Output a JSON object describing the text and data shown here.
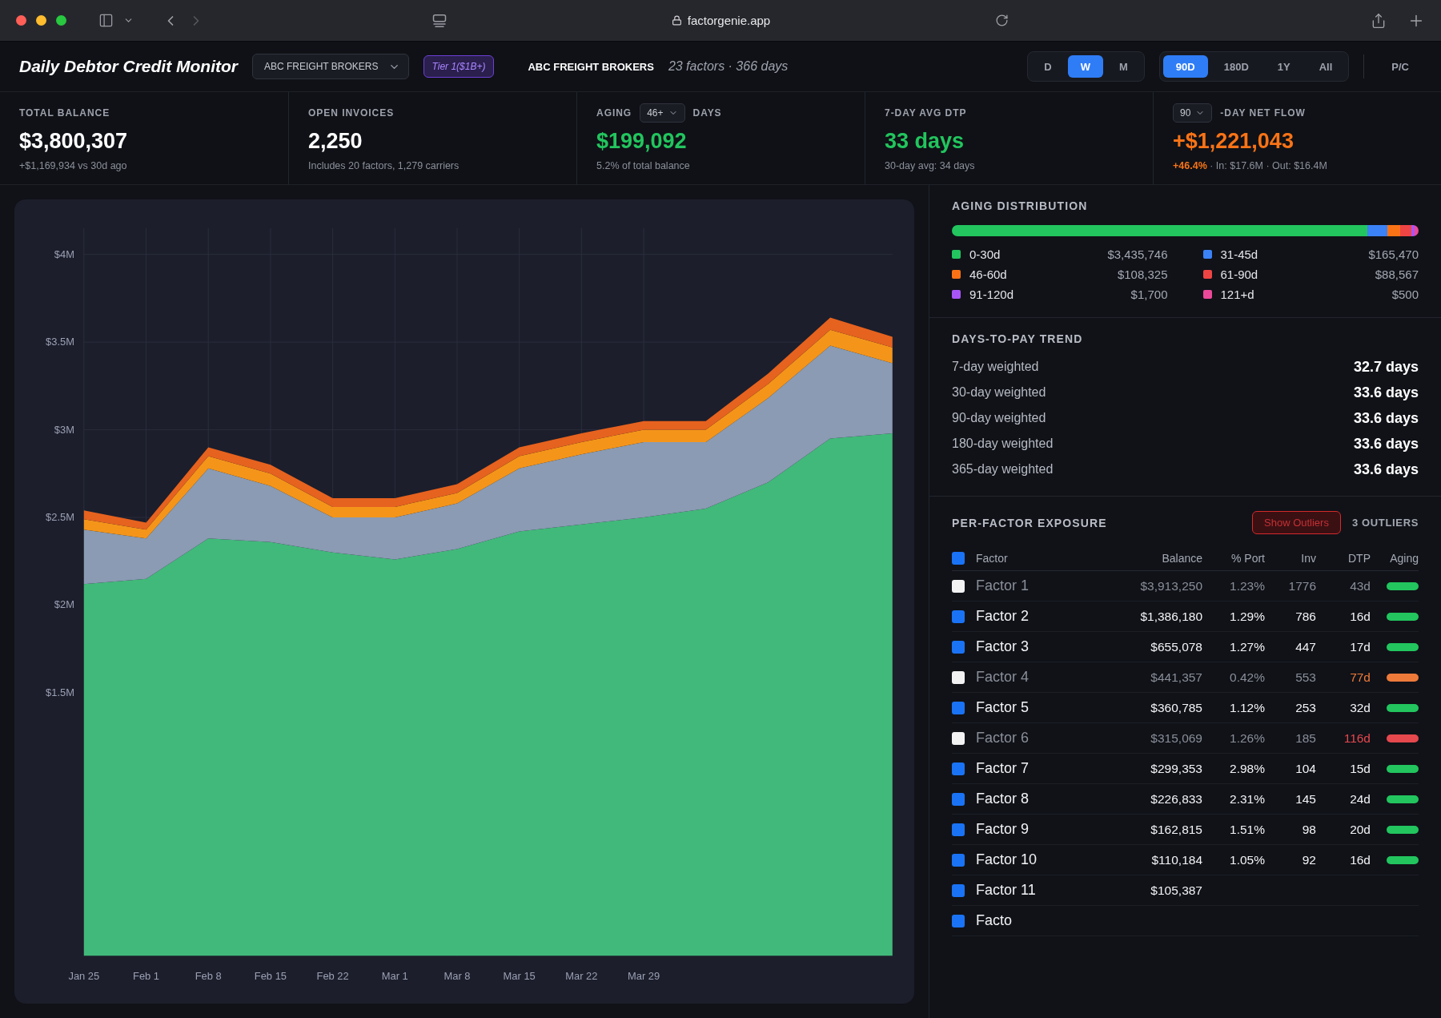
{
  "browser": {
    "url": "factorgenie.app"
  },
  "header": {
    "title": "Daily Debtor Credit Monitor",
    "broker_select": "ABC FREIGHT BROKERS",
    "tier_badge": "Tier 1($1B+)",
    "broker_name": "ABC FREIGHT BROKERS",
    "summary": "23 factors · 366 days",
    "range_groups": [
      {
        "options": [
          {
            "label": "D",
            "selected": false
          },
          {
            "label": "W",
            "selected": true
          },
          {
            "label": "M",
            "selected": false
          }
        ]
      },
      {
        "options": [
          {
            "label": "90D",
            "selected": true
          },
          {
            "label": "180D",
            "selected": false
          },
          {
            "label": "1Y",
            "selected": false
          },
          {
            "label": "All",
            "selected": false
          }
        ]
      }
    ],
    "pc_toggle": {
      "label": "P/C",
      "selected": false
    }
  },
  "kpis": [
    {
      "label_parts": [
        {
          "kind": "text",
          "text": "TOTAL BALANCE"
        }
      ],
      "value": "$3,800,307",
      "color": "#ffffff",
      "note": "+$1,169,934 vs 30d ago"
    },
    {
      "label_parts": [
        {
          "kind": "text",
          "text": "OPEN INVOICES"
        }
      ],
      "value": "2,250",
      "color": "#ffffff",
      "note": "Includes 20 factors, 1,279 carriers"
    },
    {
      "label_parts": [
        {
          "kind": "text",
          "text": "AGING"
        },
        {
          "kind": "select",
          "value": "46+"
        },
        {
          "kind": "text",
          "text": "DAYS"
        }
      ],
      "value": "$199,092",
      "color": "#22c55e",
      "note": "5.2% of total balance"
    },
    {
      "label_parts": [
        {
          "kind": "text",
          "text": "7-DAY AVG DTP"
        }
      ],
      "value": "33 days",
      "color": "#22c55e",
      "note": "30-day avg: 34 days"
    },
    {
      "label_parts": [
        {
          "kind": "select",
          "value": "90"
        },
        {
          "kind": "text",
          "text": "-DAY NET FLOW"
        }
      ],
      "value": "+$1,221,043",
      "color": "#f97316",
      "note_lead": "+46.4%",
      "note": "· In: $17.6M · Out: $16.4M"
    }
  ],
  "chart": {
    "chart_data": {
      "type": "area",
      "stacked": true,
      "grid": true,
      "categories": [
        "Jan 25",
        "Feb 1",
        "Feb 8",
        "Feb 15",
        "Feb 22",
        "Mar 1",
        "Mar 8",
        "Mar 15",
        "Mar 22",
        "Mar 29",
        null,
        null,
        null,
        null
      ],
      "ylim": [
        0,
        4150000
      ],
      "yticks": [
        {
          "value": 1500000,
          "label": "$1.5M"
        },
        {
          "value": 2000000,
          "label": "$2M"
        },
        {
          "value": 2500000,
          "label": "$2.5M"
        },
        {
          "value": 3000000,
          "label": "$3M"
        },
        {
          "value": 3500000,
          "label": "$3.5M"
        },
        {
          "value": 4000000,
          "label": "$4M"
        }
      ],
      "series": [
        {
          "color": "#41b97a",
          "values": [
            2120000,
            2150000,
            2380000,
            2360000,
            2300000,
            2260000,
            2320000,
            2420000,
            2460000,
            2500000,
            2550000,
            2700000,
            2950000,
            2980000
          ]
        },
        {
          "color": "#8a9bb3",
          "values": [
            310000,
            230000,
            400000,
            320000,
            200000,
            240000,
            260000,
            360000,
            400000,
            430000,
            380000,
            480000,
            530000,
            400000
          ]
        },
        {
          "color": "#f4951a",
          "values": [
            60000,
            50000,
            70000,
            70000,
            60000,
            60000,
            60000,
            70000,
            70000,
            70000,
            70000,
            80000,
            90000,
            90000
          ]
        },
        {
          "color": "#e6621f",
          "values": [
            50000,
            40000,
            50000,
            50000,
            50000,
            50000,
            50000,
            50000,
            50000,
            50000,
            50000,
            60000,
            70000,
            60000
          ]
        }
      ]
    }
  },
  "aging_distribution": {
    "title": "AGING DISTRIBUTION",
    "buckets": [
      {
        "label": "0-30d",
        "amount": "$3,435,746",
        "color": "#22c55e"
      },
      {
        "label": "31-45d",
        "amount": "$165,470",
        "color": "#3b82f6"
      },
      {
        "label": "46-60d",
        "amount": "$108,325",
        "color": "#f97316"
      },
      {
        "label": "61-90d",
        "amount": "$88,567",
        "color": "#ef4444"
      },
      {
        "label": "91-120d",
        "amount": "$1,700",
        "color": "#a855f7"
      },
      {
        "label": "121+d",
        "amount": "$500",
        "color": "#ec4899"
      }
    ]
  },
  "dtp_trend": {
    "title": "DAYS-TO-PAY TREND",
    "rows": [
      {
        "label": "7-day weighted",
        "value": "32.7 days"
      },
      {
        "label": "30-day weighted",
        "value": "33.6 days"
      },
      {
        "label": "90-day weighted",
        "value": "33.6 days"
      },
      {
        "label": "180-day weighted",
        "value": "33.6 days"
      },
      {
        "label": "365-day weighted",
        "value": "33.6 days"
      }
    ]
  },
  "exposure": {
    "title": "PER-FACTOR EXPOSURE",
    "outliers_button": "Show Outliers",
    "outliers_count": "3 OUTLIERS",
    "select_all": {
      "label": "Factor",
      "checked": true
    },
    "columns": [
      "Balance",
      "% Port",
      "Inv",
      "DTP",
      "Aging"
    ],
    "rows": [
      {
        "name": "Factor 1",
        "checked": false,
        "balance": "$3,913,250",
        "port": "1.23%",
        "inv": "1776",
        "dtp": "43d",
        "flagged": false,
        "color": "#22c55e"
      },
      {
        "name": "Factor 2",
        "checked": true,
        "balance": "$1,386,180",
        "port": "1.29%",
        "inv": "786",
        "dtp": "16d",
        "flagged": false,
        "color": "#22c55e"
      },
      {
        "name": "Factor 3",
        "checked": true,
        "balance": "$655,078",
        "port": "1.27%",
        "inv": "447",
        "dtp": "17d",
        "flagged": false,
        "color": "#22c55e"
      },
      {
        "name": "Factor 4",
        "checked": false,
        "balance": "$441,357",
        "port": "0.42%",
        "inv": "553",
        "dtp": "77d",
        "flagged": true,
        "color": "#ee7a3a"
      },
      {
        "name": "Factor 5",
        "checked": true,
        "balance": "$360,785",
        "port": "1.12%",
        "inv": "253",
        "dtp": "32d",
        "flagged": false,
        "color": "#22c55e"
      },
      {
        "name": "Factor 6",
        "checked": false,
        "balance": "$315,069",
        "port": "1.26%",
        "inv": "185",
        "dtp": "116d",
        "flagged": true,
        "color": "#e5484d"
      },
      {
        "name": "Factor 7",
        "checked": true,
        "balance": "$299,353",
        "port": "2.98%",
        "inv": "104",
        "dtp": "15d",
        "flagged": false,
        "color": "#22c55e"
      },
      {
        "name": "Factor 8",
        "checked": true,
        "balance": "$226,833",
        "port": "2.31%",
        "inv": "145",
        "dtp": "24d",
        "flagged": false,
        "color": "#22c55e"
      },
      {
        "name": "Factor 9",
        "checked": true,
        "balance": "$162,815",
        "port": "1.51%",
        "inv": "98",
        "dtp": "20d",
        "flagged": false,
        "color": "#22c55e"
      },
      {
        "name": "Factor 10",
        "checked": true,
        "balance": "$110,184",
        "port": "1.05%",
        "inv": "92",
        "dtp": "16d",
        "flagged": false,
        "color": "#22c55e"
      },
      {
        "name": "Factor 11",
        "checked": true,
        "balance": "$105,387"
      },
      {
        "name": "Facto",
        "checked": true
      }
    ]
  }
}
